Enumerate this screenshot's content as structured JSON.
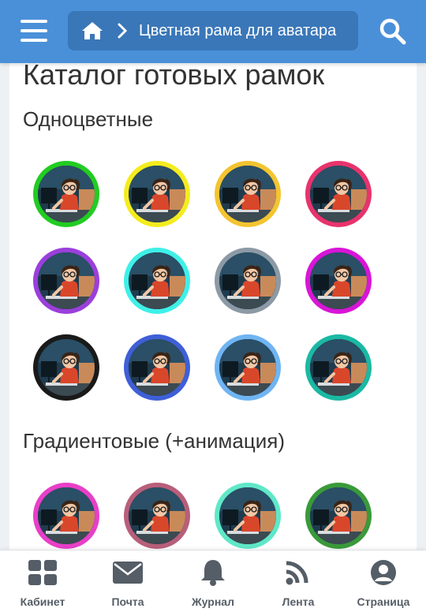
{
  "header": {
    "breadcrumb_text": "Цветная рама для аватара"
  },
  "main": {
    "page_title": "Каталог готовых рамок",
    "sections": [
      {
        "title": "Одноцветные",
        "frames": [
          {
            "color": "#22cc22"
          },
          {
            "color": "#f5ec1e"
          },
          {
            "color": "#f4c430"
          },
          {
            "color": "#e8336d"
          },
          {
            "color": "#9b3fdc"
          },
          {
            "color": "#3ff0e8"
          },
          {
            "color": "#8c9aa6"
          },
          {
            "color": "#d815d8"
          },
          {
            "color": "#1a1a1a"
          },
          {
            "color": "#3f5fd8"
          },
          {
            "color": "#6fb5f2"
          },
          {
            "color": "#1ab9a3"
          }
        ]
      },
      {
        "title": "Градиентовые (+анимация)",
        "frames": [
          {
            "color": "#e83fc8"
          },
          {
            "color": "#b85f7a"
          },
          {
            "color": "#5fe8c8"
          },
          {
            "color": "#3a9a3a"
          }
        ]
      }
    ]
  },
  "bottom_nav": [
    {
      "label": "Кабинет",
      "icon": "grid-icon"
    },
    {
      "label": "Почта",
      "icon": "envelope-icon"
    },
    {
      "label": "Журнал",
      "icon": "bell-icon"
    },
    {
      "label": "Лента",
      "icon": "rss-icon"
    },
    {
      "label": "Страница",
      "icon": "user-icon"
    }
  ],
  "colors": {
    "header_bg": "#4a90d9",
    "breadcrumb_bg": "#3a77b8",
    "nav_icon": "#555d66"
  }
}
